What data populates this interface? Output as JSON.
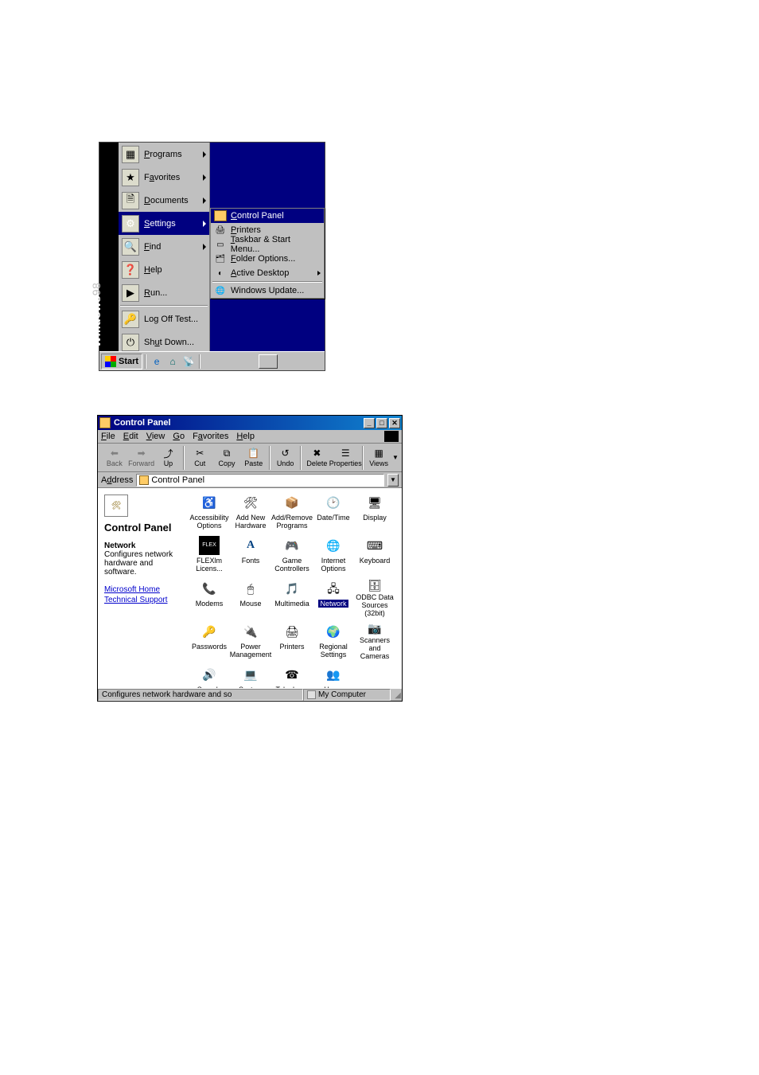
{
  "startMenu": {
    "brand": {
      "name": "Windows",
      "version": "98"
    },
    "items": [
      {
        "label": "Programs",
        "icon": "programs-icon",
        "hasSubmenu": true
      },
      {
        "label": "Favorites",
        "icon": "favorites-icon",
        "hasSubmenu": true
      },
      {
        "label": "Documents",
        "icon": "documents-icon",
        "hasSubmenu": true
      },
      {
        "label": "Settings",
        "icon": "settings-icon",
        "hasSubmenu": true,
        "highlighted": true
      },
      {
        "label": "Find",
        "icon": "find-icon",
        "hasSubmenu": true
      },
      {
        "label": "Help",
        "icon": "help-icon",
        "hasSubmenu": false
      },
      {
        "label": "Run...",
        "icon": "run-icon",
        "hasSubmenu": false
      },
      {
        "separator": true
      },
      {
        "label": "Log Off Test...",
        "icon": "logoff-icon",
        "hasSubmenu": false
      },
      {
        "label": "Shut Down...",
        "icon": "shutdown-icon",
        "hasSubmenu": false
      }
    ],
    "settingsSubmenu": [
      {
        "label": "Control Panel",
        "icon": "control-panel-icon",
        "highlighted": true
      },
      {
        "label": "Printers",
        "icon": "printers-icon"
      },
      {
        "label": "Taskbar & Start Menu...",
        "icon": "taskbar-icon"
      },
      {
        "label": "Folder Options...",
        "icon": "folder-options-icon"
      },
      {
        "label": "Active Desktop",
        "icon": "active-desktop-icon",
        "hasSubmenu": true
      },
      {
        "separator": true
      },
      {
        "label": "Windows Update...",
        "icon": "windows-update-icon"
      }
    ],
    "taskbar": {
      "startLabel": "Start",
      "quickLaunch": [
        {
          "name": "ie-icon"
        },
        {
          "name": "desktop-icon"
        },
        {
          "name": "channels-icon"
        }
      ]
    }
  },
  "controlPanel": {
    "title": "Control Panel",
    "menus": [
      {
        "label": "File"
      },
      {
        "label": "Edit"
      },
      {
        "label": "View"
      },
      {
        "label": "Go"
      },
      {
        "label": "Favorites"
      },
      {
        "label": "Help"
      }
    ],
    "toolbar": [
      {
        "name": "back-button",
        "label": "Back",
        "icon": "arrow-left-icon",
        "enabled": false
      },
      {
        "name": "forward-button",
        "label": "Forward",
        "icon": "arrow-right-icon",
        "enabled": false
      },
      {
        "name": "up-button",
        "label": "Up",
        "icon": "folder-up-icon",
        "enabled": true
      },
      {
        "sep": true
      },
      {
        "name": "cut-button",
        "label": "Cut",
        "icon": "cut-icon",
        "enabled": true
      },
      {
        "name": "copy-button",
        "label": "Copy",
        "icon": "copy-icon",
        "enabled": true
      },
      {
        "name": "paste-button",
        "label": "Paste",
        "icon": "paste-icon",
        "enabled": true
      },
      {
        "sep": true
      },
      {
        "name": "undo-button",
        "label": "Undo",
        "icon": "undo-icon",
        "enabled": true
      },
      {
        "sep": true
      },
      {
        "name": "delete-button",
        "label": "Delete",
        "icon": "delete-icon",
        "enabled": true
      },
      {
        "name": "properties-button",
        "label": "Properties",
        "icon": "properties-icon",
        "enabled": true
      },
      {
        "sep": true
      },
      {
        "name": "views-button",
        "label": "Views",
        "icon": "views-icon",
        "enabled": true
      }
    ],
    "addressLabel": "Address",
    "addressValue": "Control Panel",
    "leftPane": {
      "heading": "Control Panel",
      "selectedName": "Network",
      "selectedDesc": "Configures network hardware and software.",
      "links": [
        "Microsoft Home",
        "Technical Support"
      ]
    },
    "icons": [
      {
        "label": "Accessibility Options",
        "glyph": "♿"
      },
      {
        "label": "Add New Hardware",
        "glyph": "🛠"
      },
      {
        "label": "Add/Remove Programs",
        "glyph": "📦"
      },
      {
        "label": "Date/Time",
        "glyph": "🕑"
      },
      {
        "label": "Display",
        "glyph": "🖥"
      },
      {
        "label": "FLEXlm Licens...",
        "glyph": "FLEX"
      },
      {
        "label": "Fonts",
        "glyph": "A"
      },
      {
        "label": "Game Controllers",
        "glyph": "🎮"
      },
      {
        "label": "Internet Options",
        "glyph": "🌐"
      },
      {
        "label": "Keyboard",
        "glyph": "⌨"
      },
      {
        "label": "Modems",
        "glyph": "📞"
      },
      {
        "label": "Mouse",
        "glyph": "🖱"
      },
      {
        "label": "Multimedia",
        "glyph": "🎵"
      },
      {
        "label": "Network",
        "glyph": "🖧",
        "selected": true
      },
      {
        "label": "ODBC Data Sources (32bit)",
        "glyph": "🗄"
      },
      {
        "label": "Passwords",
        "glyph": "🔑"
      },
      {
        "label": "Power Management",
        "glyph": "🔌"
      },
      {
        "label": "Printers",
        "glyph": "🖨"
      },
      {
        "label": "Regional Settings",
        "glyph": "🌍"
      },
      {
        "label": "Scanners and Cameras",
        "glyph": "📷"
      },
      {
        "label": "Sounds",
        "glyph": "🔊"
      },
      {
        "label": "System",
        "glyph": "💻"
      },
      {
        "label": "Telephony",
        "glyph": "☎"
      },
      {
        "label": "Users",
        "glyph": "👥"
      }
    ],
    "status": {
      "left": "Configures network hardware and so",
      "rightIcon": "my-computer-icon",
      "right": "My Computer"
    }
  }
}
